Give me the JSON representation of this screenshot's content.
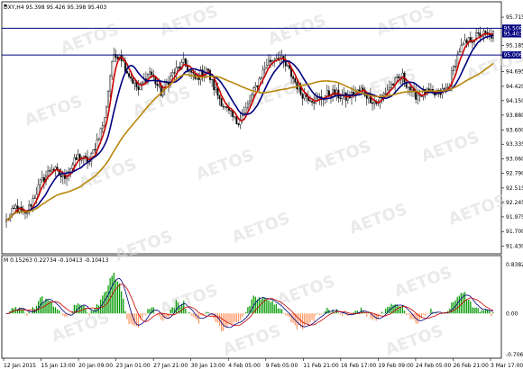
{
  "chart_data": [
    {
      "type": "candlestick",
      "title": "DXY,H4  95.398 95.426 95.398 95.403",
      "y_ticks": [
        "95.715",
        "95.185",
        "94.695",
        "94.420",
        "94.150",
        "93.880",
        "93.600",
        "93.335",
        "93.060",
        "92.790",
        "92.515",
        "92.245",
        "91.975",
        "91.700",
        "91.430"
      ],
      "y_tick_values": [
        95.715,
        95.185,
        94.695,
        94.42,
        94.15,
        93.88,
        93.6,
        93.335,
        93.06,
        92.79,
        92.515,
        92.245,
        91.975,
        91.7,
        91.43
      ],
      "ylim": [
        91.35,
        95.8
      ],
      "price_badges": [
        {
          "text": "95.508",
          "value": 95.508
        },
        {
          "text": "95.403",
          "value": 95.403
        }
      ],
      "levels": [
        {
          "text": "95.006",
          "value": 95.006,
          "color": "#000080"
        },
        {
          "text": "95.508",
          "value": 95.508,
          "color": "#000080"
        }
      ],
      "x_ticks": [
        "12 Jan 2015",
        "15 Jan 13:00",
        "20 Jan 09:00",
        "23 Jan 01:00",
        "27 Jan 21:00",
        "30 Jan 13:00",
        "4 Feb 05:00",
        "9 Feb 05:00",
        "11 Feb 21:00",
        "16 Feb 17:00",
        "19 Feb 09:00",
        "24 Feb 05:00",
        "26 Feb 21:00",
        "3 Mar 17:00"
      ],
      "anchors": [
        [
          0,
          91.9
        ],
        [
          5,
          92.15
        ],
        [
          10,
          92.0
        ],
        [
          18,
          92.6
        ],
        [
          24,
          92.9
        ],
        [
          30,
          92.7
        ],
        [
          38,
          93.1
        ],
        [
          44,
          93.0
        ],
        [
          52,
          93.8
        ],
        [
          56,
          94.9
        ],
        [
          60,
          95.05
        ],
        [
          64,
          94.7
        ],
        [
          70,
          94.35
        ],
        [
          76,
          94.7
        ],
        [
          82,
          94.3
        ],
        [
          88,
          94.65
        ],
        [
          94,
          94.85
        ],
        [
          100,
          94.55
        ],
        [
          106,
          94.75
        ],
        [
          110,
          94.4
        ],
        [
          116,
          94.0
        ],
        [
          122,
          93.75
        ],
        [
          126,
          93.9
        ],
        [
          132,
          94.4
        ],
        [
          138,
          94.85
        ],
        [
          144,
          95.0
        ],
        [
          150,
          94.7
        ],
        [
          156,
          94.3
        ],
        [
          164,
          94.15
        ],
        [
          172,
          94.3
        ],
        [
          180,
          94.2
        ],
        [
          188,
          94.35
        ],
        [
          196,
          94.1
        ],
        [
          204,
          94.45
        ],
        [
          210,
          94.6
        ],
        [
          216,
          94.25
        ],
        [
          222,
          94.3
        ],
        [
          228,
          94.25
        ],
        [
          234,
          94.4
        ],
        [
          240,
          95.1
        ],
        [
          246,
          95.3
        ],
        [
          252,
          95.4
        ],
        [
          256,
          95.35
        ],
        [
          258,
          95.4
        ]
      ],
      "series": [
        {
          "name": "MA fast",
          "color": "#cc0000",
          "period": 5
        },
        {
          "name": "MA mid",
          "color": "#000080",
          "period": 12
        },
        {
          "name": "MA slow",
          "color": "#b8860b",
          "period": 40
        }
      ],
      "watermark": "AETOS"
    },
    {
      "type": "histogram",
      "title": "M  0.15263  0.22734  -0.10413  -0.10413",
      "y_ticks": [
        "0.8382837",
        "0.00",
        "-0.7063437"
      ],
      "y_tick_values": [
        0.8382837,
        0.0,
        -0.7063437
      ],
      "ylim": [
        -0.7063437,
        0.8382837
      ],
      "positive_color": "#009900",
      "negative_color": "#ff9966"
    }
  ]
}
